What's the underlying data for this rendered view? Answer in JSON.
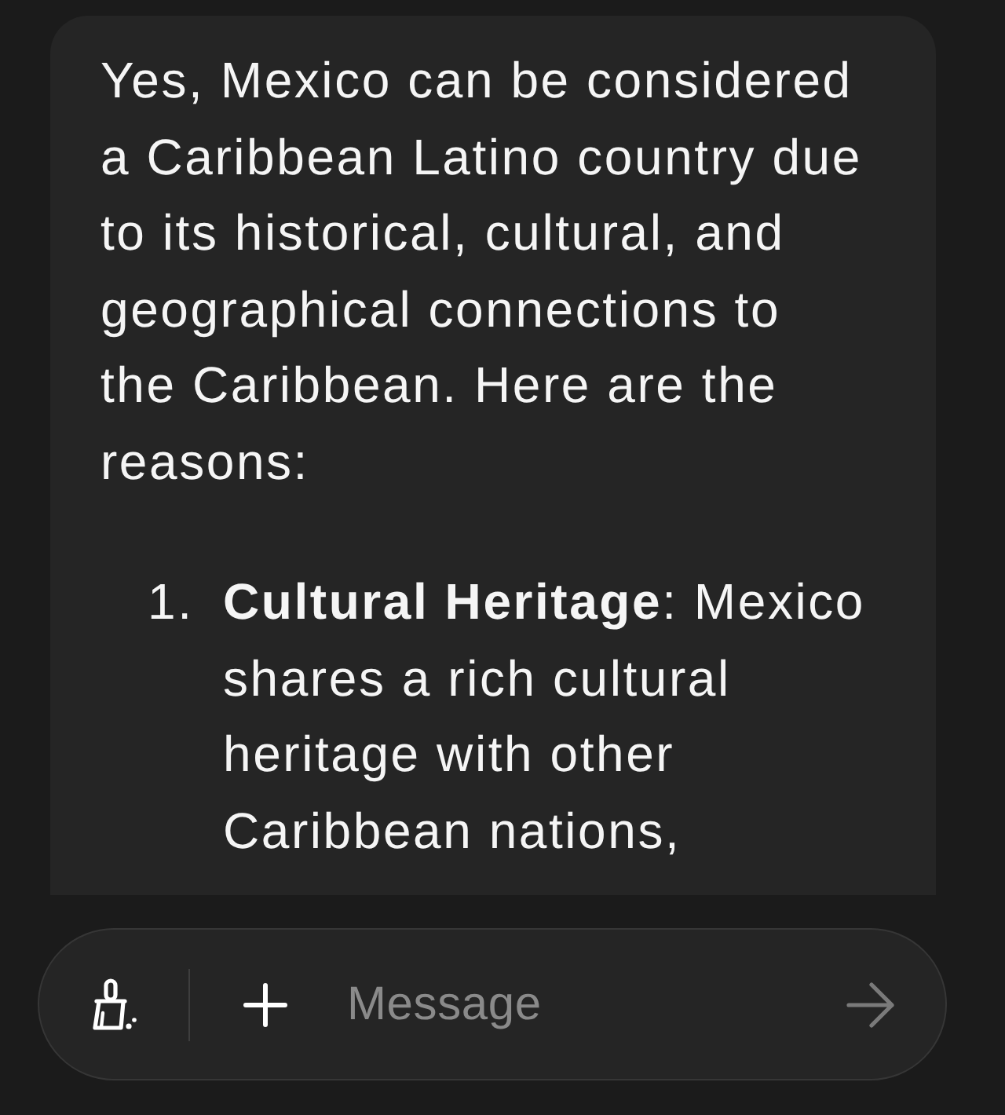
{
  "message": {
    "text": "Yes, Mexico can be considered a Caribbean Latino country due to its historical, cultural, and geographical connections to the Caribbean. Here are the reasons:",
    "list_items": [
      {
        "number": "1.",
        "text": "**Cultural Heritage**: Mexico shares a rich cultural heritage with other Caribbean nations,"
      }
    ]
  },
  "composer": {
    "placeholder": "Message"
  }
}
